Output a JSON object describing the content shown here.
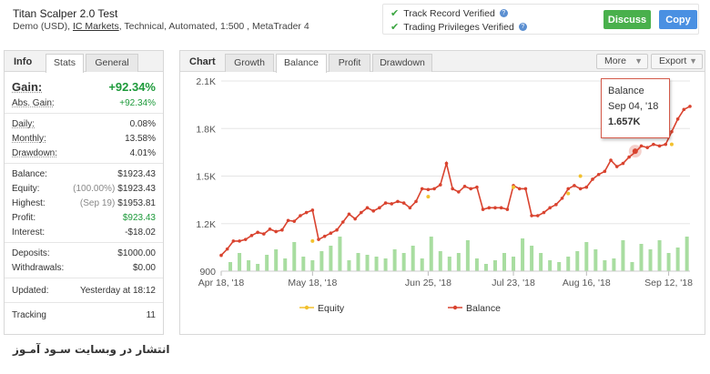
{
  "header": {
    "title": "Titan Scalper 2.0 Test",
    "subtitle_pre": "Demo (USD),",
    "subtitle_link": "IC Markets",
    "subtitle_post": ", Technical, Automated, 1:500 , MetaTrader 4",
    "verified_1": "Track Record Verified",
    "verified_2": "Trading Privileges Verified",
    "discuss": "Discuss",
    "copy": "Copy"
  },
  "left_panel": {
    "title": "Info",
    "tabs": [
      "Stats",
      "General"
    ],
    "gain_label": "Gain:",
    "gain_value": "+92.34%",
    "abs_gain_label": "Abs. Gain:",
    "abs_gain_value": "+92.34%",
    "daily_label": "Daily:",
    "daily_value": "0.08%",
    "monthly_label": "Monthly:",
    "monthly_value": "13.58%",
    "drawdown_label": "Drawdown:",
    "drawdown_value": "4.01%",
    "balance_label": "Balance:",
    "balance_value": "$1923.43",
    "equity_label": "Equity:",
    "equity_pct": "(100.00%)",
    "equity_value": "$1923.43",
    "highest_label": "Highest:",
    "highest_date": "(Sep 19)",
    "highest_value": "$1953.81",
    "profit_label": "Profit:",
    "profit_value": "$923.43",
    "interest_label": "Interest:",
    "interest_value": "-$18.02",
    "deposits_label": "Deposits:",
    "deposits_value": "$1000.00",
    "withdrawals_label": "Withdrawals:",
    "withdrawals_value": "$0.00",
    "updated_label": "Updated:",
    "updated_value": "Yesterday at 18:12",
    "tracking_label": "Tracking",
    "tracking_value": "11"
  },
  "chart_panel": {
    "title": "Chart",
    "tabs": [
      "Growth",
      "Balance",
      "Profit",
      "Drawdown"
    ],
    "more": "More",
    "export": "Export",
    "tooltip_series": "Balance",
    "tooltip_date": "Sep 04, '18",
    "tooltip_value": "1.657K"
  },
  "colors": {
    "balance": "#d9432f",
    "equity": "#f2c12e",
    "bars": "#a8dda0",
    "green_button": "#49b04c",
    "blue_button": "#4a90e2",
    "gain_green": "#1d9a3a"
  },
  "chart_data": {
    "type": "line",
    "ylim": [
      900,
      2100
    ],
    "yticks": [
      "2.1K",
      "1.8K",
      "1.5K",
      "1.2K",
      "900"
    ],
    "ytick_values": [
      2100,
      1800,
      1500,
      1200,
      900
    ],
    "xticks": [
      "Apr 18, '18",
      "May 18, '18",
      "Jun 25, '18",
      "Jul 23, '18",
      "Aug 16, '18",
      "Sep 12, '18"
    ],
    "xtick_days": [
      0,
      30,
      68,
      96,
      120,
      147
    ],
    "x_max_day": 154,
    "legend": [
      "Equity",
      "Balance"
    ],
    "series": [
      {
        "name": "Balance",
        "x": [
          0,
          2,
          4,
          6,
          8,
          10,
          12,
          14,
          16,
          18,
          20,
          22,
          24,
          26,
          28,
          30,
          32,
          34,
          36,
          38,
          40,
          42,
          44,
          46,
          48,
          50,
          52,
          54,
          56,
          58,
          60,
          62,
          64,
          66,
          68,
          70,
          72,
          74,
          76,
          78,
          80,
          82,
          84,
          86,
          88,
          90,
          92,
          94,
          96,
          98,
          100,
          102,
          104,
          106,
          108,
          110,
          112,
          114,
          116,
          118,
          120,
          122,
          124,
          126,
          128,
          130,
          132,
          134,
          136,
          138,
          140,
          142,
          144,
          146,
          148,
          150,
          152,
          154
        ],
        "values": [
          1000,
          1040,
          1090,
          1090,
          1100,
          1125,
          1145,
          1135,
          1165,
          1150,
          1160,
          1220,
          1215,
          1250,
          1270,
          1285,
          1100,
          1120,
          1140,
          1160,
          1210,
          1260,
          1230,
          1270,
          1300,
          1280,
          1300,
          1330,
          1325,
          1340,
          1330,
          1300,
          1340,
          1420,
          1415,
          1420,
          1445,
          1580,
          1420,
          1400,
          1435,
          1420,
          1430,
          1290,
          1300,
          1300,
          1300,
          1290,
          1440,
          1420,
          1420,
          1250,
          1250,
          1270,
          1300,
          1320,
          1360,
          1420,
          1440,
          1420,
          1430,
          1480,
          1510,
          1530,
          1600,
          1560,
          1580,
          1620,
          1650,
          1690,
          1680,
          1700,
          1690,
          1700,
          1780,
          1860,
          1920,
          1940
        ]
      },
      {
        "name": "Equity",
        "x": [
          30,
          68,
          96,
          114,
          118,
          148
        ],
        "values": [
          1090,
          1370,
          1430,
          1390,
          1500,
          1700
        ]
      }
    ],
    "volume_bars": {
      "x": [
        3,
        6,
        9,
        12,
        15,
        18,
        21,
        24,
        27,
        30,
        33,
        36,
        39,
        42,
        45,
        48,
        51,
        54,
        57,
        60,
        63,
        66,
        69,
        72,
        75,
        78,
        81,
        84,
        87,
        90,
        93,
        96,
        99,
        102,
        105,
        108,
        111,
        114,
        117,
        120,
        123,
        126,
        129,
        132,
        135,
        138,
        141,
        144,
        147,
        150,
        153
      ],
      "values": [
        0.25,
        0.5,
        0.3,
        0.2,
        0.45,
        0.6,
        0.35,
        0.8,
        0.4,
        0.3,
        0.55,
        0.7,
        0.95,
        0.3,
        0.5,
        0.45,
        0.4,
        0.35,
        0.6,
        0.5,
        0.7,
        0.35,
        0.95,
        0.55,
        0.4,
        0.5,
        0.85,
        0.35,
        0.2,
        0.3,
        0.5,
        0.4,
        0.9,
        0.7,
        0.5,
        0.3,
        0.25,
        0.4,
        0.55,
        0.8,
        0.6,
        0.3,
        0.35,
        0.85,
        0.25,
        0.75,
        0.6,
        0.85,
        0.5,
        0.65,
        0.95
      ]
    }
  },
  "footer": {
    "text": "انتشار در وبسایت سـود آمـوز"
  }
}
